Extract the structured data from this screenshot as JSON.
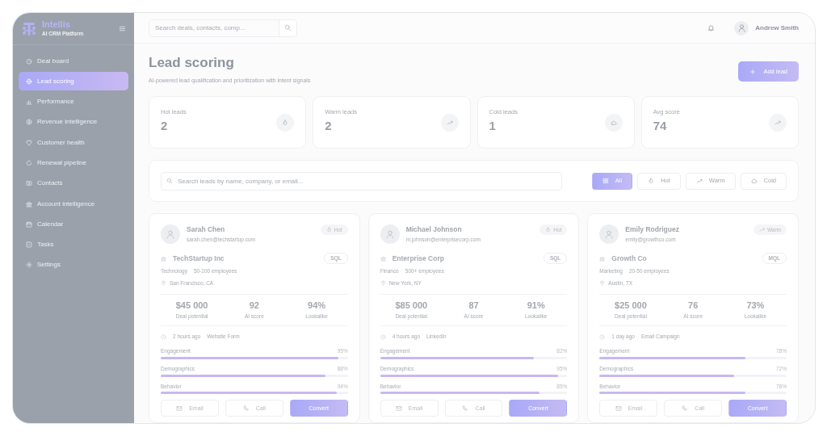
{
  "brand": {
    "name": "Intellis",
    "tagline": "AI CRM Platform"
  },
  "sidebar": {
    "items": [
      {
        "label": "Deal board",
        "selected": false
      },
      {
        "label": "Lead scoring",
        "selected": true
      },
      {
        "label": "Performance",
        "selected": false
      },
      {
        "label": "Revenue intelligence",
        "selected": false
      },
      {
        "label": "Customer health",
        "selected": false
      },
      {
        "label": "Renewal pipeline",
        "selected": false
      },
      {
        "label": "Contacts",
        "selected": false
      },
      {
        "label": "Account intelligence",
        "selected": false
      },
      {
        "label": "Calendar",
        "selected": false
      },
      {
        "label": "Tasks",
        "selected": false
      },
      {
        "label": "Settings",
        "selected": false
      }
    ]
  },
  "topbar": {
    "search": {
      "placeholder": "Search deals, contacts, comp..."
    },
    "user": {
      "name": "Andrew Smith"
    }
  },
  "page": {
    "title": "Lead scoring",
    "subtitle": "AI-powered lead qualification and prioritization with intent signals",
    "add_button": "Add lead"
  },
  "stats": [
    {
      "label": "Hot leads",
      "value": "2",
      "kind": "flame"
    },
    {
      "label": "Warm leads",
      "value": "2",
      "kind": "trend"
    },
    {
      "label": "Cold leads",
      "value": "1",
      "kind": "cloud"
    },
    {
      "label": "Avg score",
      "value": "74",
      "kind": "trend"
    }
  ],
  "filter": {
    "search": {
      "placeholder": "Search leads by name, company, or email..."
    },
    "buttons": [
      {
        "label": "All",
        "kind": "grid",
        "selected": true
      },
      {
        "label": "Hot",
        "kind": "flame",
        "selected": false
      },
      {
        "label": "Warm",
        "kind": "trend",
        "selected": false
      },
      {
        "label": "Cold",
        "kind": "cloud",
        "selected": false
      }
    ]
  },
  "leads": [
    {
      "name": "Sarah Chen",
      "email": "sarah.chen@techstartup.com",
      "tier": {
        "label": "Hot",
        "kind": "flame"
      },
      "company": "TechStartup Inc",
      "stage": "SQL",
      "industry": "Technology",
      "size": "50-100 employees",
      "location": "San Francisco, CA",
      "deal": "$45 000",
      "deal_label": "Deal potential",
      "ai_score": "92",
      "ai_label": "AI score",
      "lookalike": "94%",
      "lookalike_label": "Lookalike",
      "time": "2 hours ago",
      "source": "Website Form",
      "factors": [
        {
          "label": "Engagement",
          "reading": "95%",
          "level": 0.95
        },
        {
          "label": "Demographics",
          "reading": "88%",
          "level": 0.88
        },
        {
          "label": "Behavior",
          "reading": "94%",
          "level": 0.94
        }
      ],
      "actions": {
        "email": "Email",
        "call": "Call",
        "convert": "Convert"
      }
    },
    {
      "name": "Michael Johnson",
      "email": "m.johnson@enterprisecorp.com",
      "tier": {
        "label": "Hot",
        "kind": "flame"
      },
      "company": "Enterprise Corp",
      "stage": "SQL",
      "industry": "Finance",
      "size": "500+ employees",
      "location": "New York, NY",
      "deal": "$85 000",
      "deal_label": "Deal potential",
      "ai_score": "87",
      "ai_label": "AI score",
      "lookalike": "91%",
      "lookalike_label": "Lookalike",
      "time": "4 hours ago",
      "source": "LinkedIn",
      "factors": [
        {
          "label": "Engagement",
          "reading": "82%",
          "level": 0.82
        },
        {
          "label": "Demographics",
          "reading": "95%",
          "level": 0.95
        },
        {
          "label": "Behavior",
          "reading": "85%",
          "level": 0.85
        }
      ],
      "actions": {
        "email": "Email",
        "call": "Call",
        "convert": "Convert"
      }
    },
    {
      "name": "Emily Rodriguez",
      "email": "emily@growthco.com",
      "tier": {
        "label": "Warm",
        "kind": "trend"
      },
      "company": "Growth Co",
      "stage": "MQL",
      "industry": "Marketing",
      "size": "20-50 employees",
      "location": "Austin, TX",
      "deal": "$25 000",
      "deal_label": "Deal potential",
      "ai_score": "76",
      "ai_label": "AI score",
      "lookalike": "73%",
      "lookalike_label": "Lookalike",
      "time": "1 day ago",
      "source": "Email Campaign",
      "factors": [
        {
          "label": "Engagement",
          "reading": "78%",
          "level": 0.78
        },
        {
          "label": "Demographics",
          "reading": "72%",
          "level": 0.72
        },
        {
          "label": "Behavior",
          "reading": "78%",
          "level": 0.78
        }
      ],
      "actions": {
        "email": "Email",
        "call": "Call",
        "convert": "Convert"
      }
    }
  ]
}
